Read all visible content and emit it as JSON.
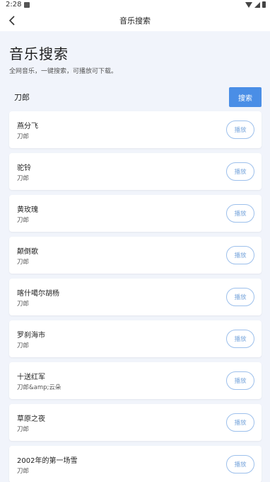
{
  "status_bar": {
    "time": "2:28"
  },
  "header": {
    "title": "音乐搜索"
  },
  "main": {
    "page_title": "音乐搜索",
    "subtitle": "全网音乐，一键搜索，可播放可下载。",
    "search": {
      "value": "刀郎",
      "button_label": "搜索"
    },
    "play_label": "播放",
    "songs": [
      {
        "title": "燕分飞",
        "artist": "刀郎"
      },
      {
        "title": "驼铃",
        "artist": "刀郎"
      },
      {
        "title": "黄玫瑰",
        "artist": "刀郎"
      },
      {
        "title": "颠倒歌",
        "artist": "刀郎"
      },
      {
        "title": "喀什噶尔胡杨",
        "artist": "刀郎"
      },
      {
        "title": "罗刹海市",
        "artist": "刀郎"
      },
      {
        "title": "十送红军",
        "artist": "刀郎&amp;云朵"
      },
      {
        "title": "草原之夜",
        "artist": "刀郎"
      },
      {
        "title": "2002年的第一场雪",
        "artist": "刀郎"
      }
    ]
  }
}
